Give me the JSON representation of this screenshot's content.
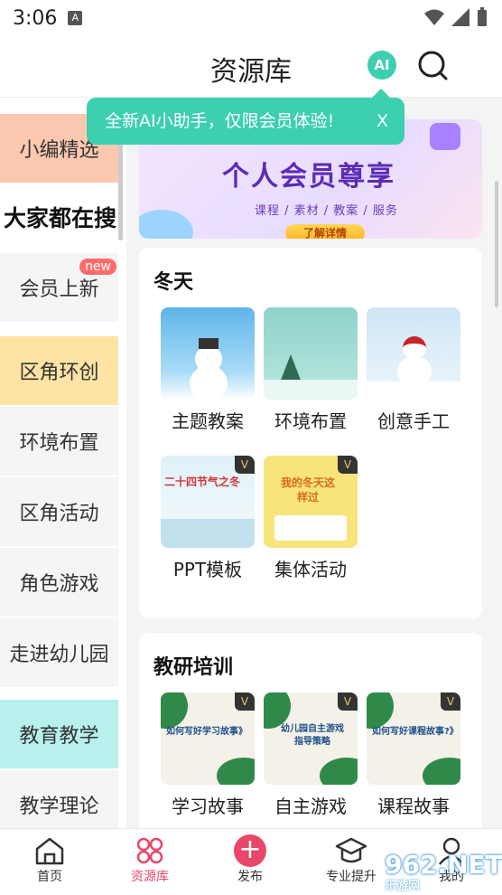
{
  "status": {
    "time": "3:06",
    "notif_icon": "A"
  },
  "header": {
    "title": "资源库",
    "ai_label": "AI"
  },
  "tooltip": {
    "text": "全新AI小助手，仅限会员体验!",
    "close": "X"
  },
  "sidebar": {
    "items": [
      {
        "label": "小编精选",
        "color": "#fcc8b0"
      },
      {
        "label": "大家都在搜",
        "active": true
      },
      {
        "label": "会员上新",
        "badge": "new"
      },
      {
        "label": "区角环创",
        "color": "#fde4a4"
      },
      {
        "label": "环境布置"
      },
      {
        "label": "区角活动"
      },
      {
        "label": "角色游戏"
      },
      {
        "label": "走进幼儿园"
      },
      {
        "label": "教育教学",
        "color": "#b8f0ee"
      },
      {
        "label": "教学理论"
      }
    ]
  },
  "banner": {
    "title": "个人会员尊享",
    "subtitle": "课程 / 素材 / 教案 / 服务",
    "button": "了解详情"
  },
  "winter": {
    "title": "冬天",
    "items": [
      {
        "label": "主题教案",
        "thumb_color": "#5fb4ea",
        "vip": false
      },
      {
        "label": "环境布置",
        "thumb_color": "#8fd3cb",
        "vip": false
      },
      {
        "label": "创意手工",
        "thumb_color": "#cfe6f6",
        "vip": false
      },
      {
        "label": "PPT模板",
        "thumb_color": "#dff1f7",
        "vip": true,
        "thumb_text": "二十四节气之冬"
      },
      {
        "label": "集体活动",
        "thumb_color": "#f7e47a",
        "vip": true,
        "thumb_text": "我的冬天这样过"
      }
    ]
  },
  "training": {
    "title": "教研培训",
    "items": [
      {
        "label": "学习故事",
        "thumb_text": "如何写好学习故事》"
      },
      {
        "label": "自主游戏",
        "thumb_text": "幼儿园自主游戏指导策略"
      },
      {
        "label": "课程故事",
        "thumb_text": "如何写好课程故事?》"
      }
    ],
    "thumb_color": "#f3f1e8",
    "accent": "#2f8a4a"
  },
  "tabbar": {
    "tabs": [
      {
        "label": "首页",
        "icon": "home-icon"
      },
      {
        "label": "资源库",
        "icon": "grid-icon",
        "active": true
      },
      {
        "label": "发布",
        "icon": "plus-icon"
      },
      {
        "label": "专业提升",
        "icon": "graduation-icon"
      },
      {
        "label": "我的",
        "icon": "user-icon"
      }
    ]
  },
  "watermark": {
    "text": "962.NET",
    "sub": "乐游网"
  },
  "colors": {
    "accent": "#3ccfb0",
    "brand": "#e8476a"
  }
}
